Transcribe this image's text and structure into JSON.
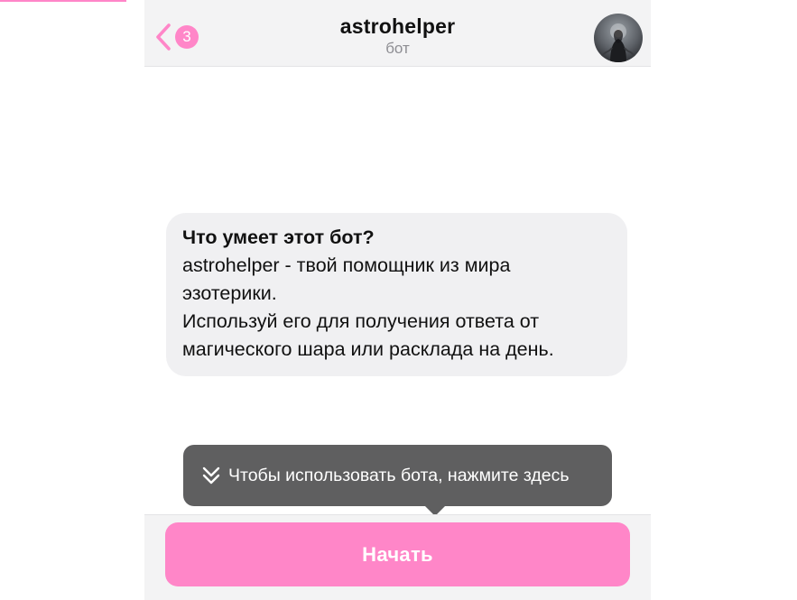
{
  "header": {
    "back_icon": "chevron-left-icon",
    "unread_count": "3",
    "title": "astrohelper",
    "subtitle": "бот",
    "avatar_icon": "bot-avatar"
  },
  "info": {
    "heading": "Что умеет этот бот?",
    "lines": [
      "astrohelper - твой помощник из мира",
      "эзотерики.",
      "Используй его для получения ответа от",
      "магического шара или расклада на день."
    ]
  },
  "tooltip": {
    "icon": "double-chevron-down-icon",
    "text": "Чтобы использовать бота, нажмите здесь"
  },
  "start_button": {
    "label": "Начать"
  },
  "colors": {
    "accent": "#ff86c8",
    "header_bg": "#f3f3f4",
    "bubble_bg": "#f0f0f2",
    "tooltip_bg": "#5f5f60"
  }
}
